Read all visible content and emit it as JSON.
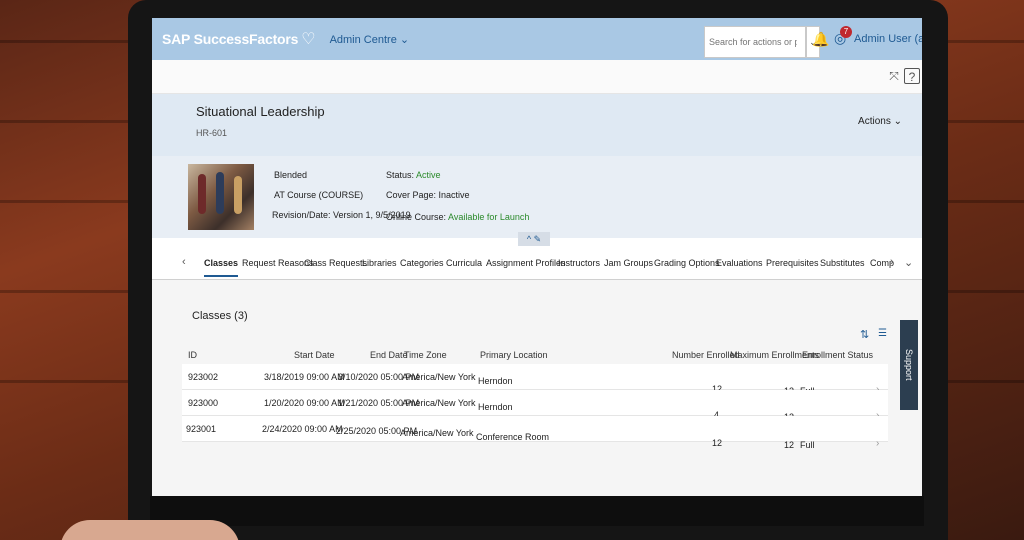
{
  "shell": {
    "logo": "SAP SuccessFactors",
    "menu": "Admin Centre ⌄",
    "search_placeholder": "Search for actions or people",
    "badge_count": "7",
    "user": "Admin User (admin) ⌄"
  },
  "header": {
    "title": "Situational Leadership",
    "code": "HR-601",
    "actions": "Actions ⌄"
  },
  "info": {
    "delivery": "Blended",
    "type": "AT Course (COURSE)",
    "revision": "Revision/Date: Version 1, 9/5/2019",
    "status_label": "Status:",
    "status_value": "Active",
    "cover_page": "Cover Page: Inactive",
    "online_label": "Online Course:",
    "online_value": "Available for Launch"
  },
  "tabs": [
    "Classes",
    "Request Reasons",
    "Class Requests",
    "Libraries",
    "Categories",
    "Curricula",
    "Assignment Profiles",
    "Instructors",
    "Jam Groups",
    "Grading Options",
    "Evaluations",
    "Prerequisites",
    "Substitutes",
    "Comp"
  ],
  "classes": {
    "title": "Classes (3)",
    "columns": [
      "ID",
      "Start Date",
      "End Date",
      "Time Zone",
      "Primary Location",
      "Number Enrolled",
      "Maximum Enrollments",
      "Enrollment Status"
    ],
    "rows": [
      {
        "id": "923002",
        "start": "3/18/2019 09:00 AM",
        "end": "3/10/2020 05:00 PM",
        "tz": "America/New York",
        "loc": "Herndon",
        "enrolled": "12",
        "max": "12",
        "status": "Full"
      },
      {
        "id": "923000",
        "start": "1/20/2020 09:00 AM",
        "end": "1/21/2020 05:00 PM",
        "tz": "America/New York",
        "loc": "Herndon",
        "enrolled": "4",
        "max": "12",
        "status": ""
      },
      {
        "id": "923001",
        "start": "2/24/2020 09:00 AM",
        "end": "2/25/2020 05:00 PM",
        "tz": "America/New York",
        "loc": "Conference Room",
        "enrolled": "12",
        "max": "12",
        "status": "Full"
      }
    ]
  },
  "support": "Support",
  "colors": {
    "shell": "#a9c8e4",
    "header": "#dfe9f3",
    "status_active": "#2b8a2b"
  }
}
